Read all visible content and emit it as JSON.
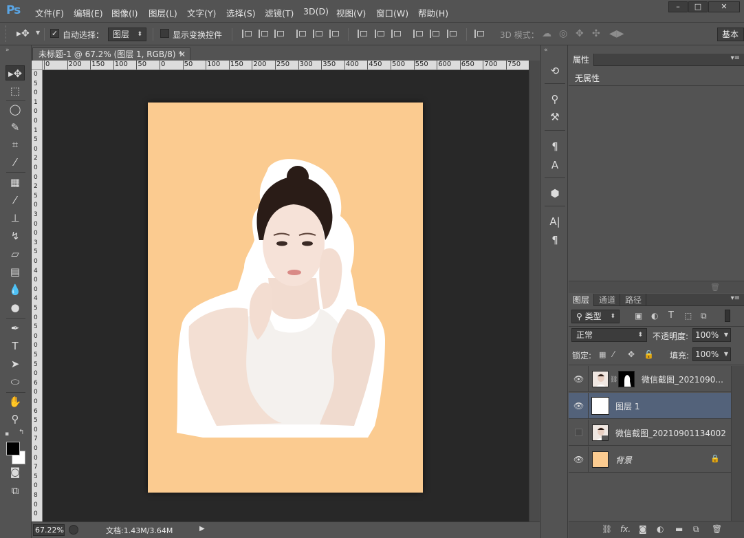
{
  "app": {
    "logo": "Ps",
    "menu": [
      "文件(F)",
      "编辑(E)",
      "图像(I)",
      "图层(L)",
      "文字(Y)",
      "选择(S)",
      "滤镜(T)",
      "3D(D)",
      "视图(V)",
      "窗口(W)",
      "帮助(H)"
    ],
    "window_controls": [
      "–",
      "□",
      "✕"
    ]
  },
  "options": {
    "auto_select_label": "自动选择：",
    "auto_select_target": "图层",
    "show_transform_label": "显示变换控件",
    "mode_3d_label": "3D 模式：",
    "workspace": "基本"
  },
  "document": {
    "tab_title": "未标题-1 @ 67.2% (图层 1, RGB/8) *",
    "tab_close": "✕",
    "ruler_h": [
      "0",
      "200",
      "150",
      "100",
      "50",
      "0",
      "50",
      "100",
      "150",
      "200",
      "250",
      "300",
      "350",
      "400",
      "450",
      "500",
      "550",
      "600",
      "650",
      "700",
      "750",
      "80"
    ],
    "ruler_v": [
      "0",
      "5",
      "0",
      "1",
      "0",
      "0",
      "1",
      "5",
      "0",
      "2",
      "0",
      "0",
      "2",
      "5",
      "0",
      "3",
      "0",
      "0",
      "3",
      "5",
      "0",
      "4",
      "0",
      "0",
      "4",
      "5",
      "0",
      "5",
      "0",
      "0",
      "5",
      "5",
      "0",
      "6",
      "0",
      "0",
      "6",
      "5",
      "0",
      "7",
      "0",
      "0",
      "7",
      "5",
      "0",
      "8",
      "0",
      "0"
    ],
    "zoom": "67.22%",
    "doc_info": "文档:1.43M/3.64M",
    "background_color": "#fbcb90"
  },
  "properties": {
    "tab": "属性",
    "empty_text": "无属性"
  },
  "layers": {
    "tabs": [
      "图层",
      "通道",
      "路径"
    ],
    "filter_kind": "类型",
    "blend_mode": "正常",
    "opacity_label": "不透明度:",
    "opacity_value": "100%",
    "lock_label": "锁定:",
    "fill_label": "填充:",
    "fill_value": "100%",
    "items": [
      {
        "name": "微信截图_2021090...",
        "visible": true,
        "selected": false
      },
      {
        "name": "图层 1",
        "visible": true,
        "selected": true
      },
      {
        "name": "微信截图_20210901134002",
        "visible": false,
        "selected": false
      },
      {
        "name": "背景",
        "visible": true,
        "selected": false
      }
    ]
  }
}
